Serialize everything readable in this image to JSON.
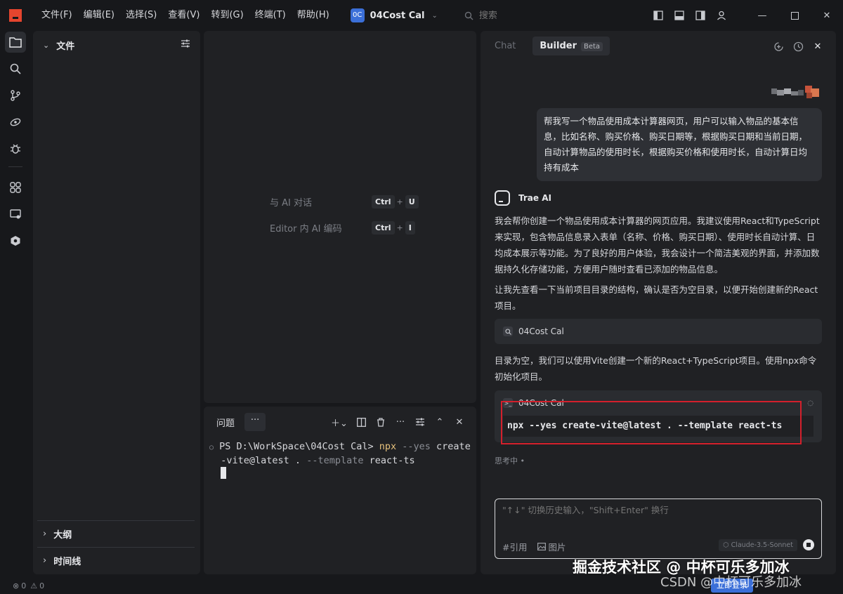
{
  "titlebar": {
    "menu": [
      "文件(F)",
      "编辑(E)",
      "选择(S)",
      "查看(V)",
      "转到(G)",
      "终端(T)",
      "帮助(H)"
    ],
    "project_badge": "0C",
    "project_name": "04Cost Cal",
    "search_placeholder": "搜索"
  },
  "explorer": {
    "title": "文件",
    "outline": "大纲",
    "timeline": "时间线"
  },
  "editor": {
    "hint_chat": "与 AI 对话",
    "hint_chat_keys": [
      "Ctrl",
      "U"
    ],
    "hint_inline": "Editor 内 AI 编码",
    "hint_inline_keys": [
      "Ctrl",
      "I"
    ]
  },
  "terminal": {
    "tab": "问题",
    "more": "···",
    "prompt": "PS D:\\WorkSpace\\04Cost Cal> ",
    "cmd": "npx",
    "arg1": " --yes",
    "rest1": " create",
    "line2a": "-vite@latest . ",
    "line2b": "--template",
    "line2c": " react-ts"
  },
  "chat": {
    "tab_chat": "Chat",
    "tab_builder": "Builder",
    "beta": "Beta",
    "user_message": "帮我写一个物品使用成本计算器网页，用户可以输入物品的基本信息，比如名称、购买价格、购买日期等，根据购买日期和当前日期，自动计算物品的使用时长，根据购买价格和使用时长，自动计算日均持有成本",
    "ai_name": "Trae AI",
    "para1": "我会帮你创建一个物品使用成本计算器的网页应用。我建议使用React和TypeScript来实现，包含物品信息录入表单（名称、价格、购买日期）、使用时长自动计算、日均成本展示等功能。为了良好的用户体验，我会设计一个简洁美观的界面，并添加数据持久化存储功能，方便用户随时查看已添加的物品信息。",
    "para2": "让我先查看一下当前项目目录的结构，确认是否为空目录，以便开始创建新的React项目。",
    "tool1_label": "04Cost Cal",
    "para3": "目录为空，我们可以使用Vite创建一个新的React+TypeScript项目。使用npx命令初始化项目。",
    "tool2_label": "04Cost Cal",
    "command": "npx --yes create-vite@latest . --template react-ts",
    "thinking": "思考中 •",
    "input_placeholder": "\"↑↓\" 切换历史输入，\"Shift+Enter\" 换行",
    "ref_label": "引用",
    "image_label": "图片",
    "model": "Claude-3.5-Sonnet"
  },
  "statusbar": {
    "errors": "0",
    "warnings": "0",
    "login": "立即登录"
  },
  "watermark": {
    "line1": "掘金技术社区 @ 中杯可乐多加冰",
    "line2": "CSDN @中杯可乐多加冰"
  }
}
